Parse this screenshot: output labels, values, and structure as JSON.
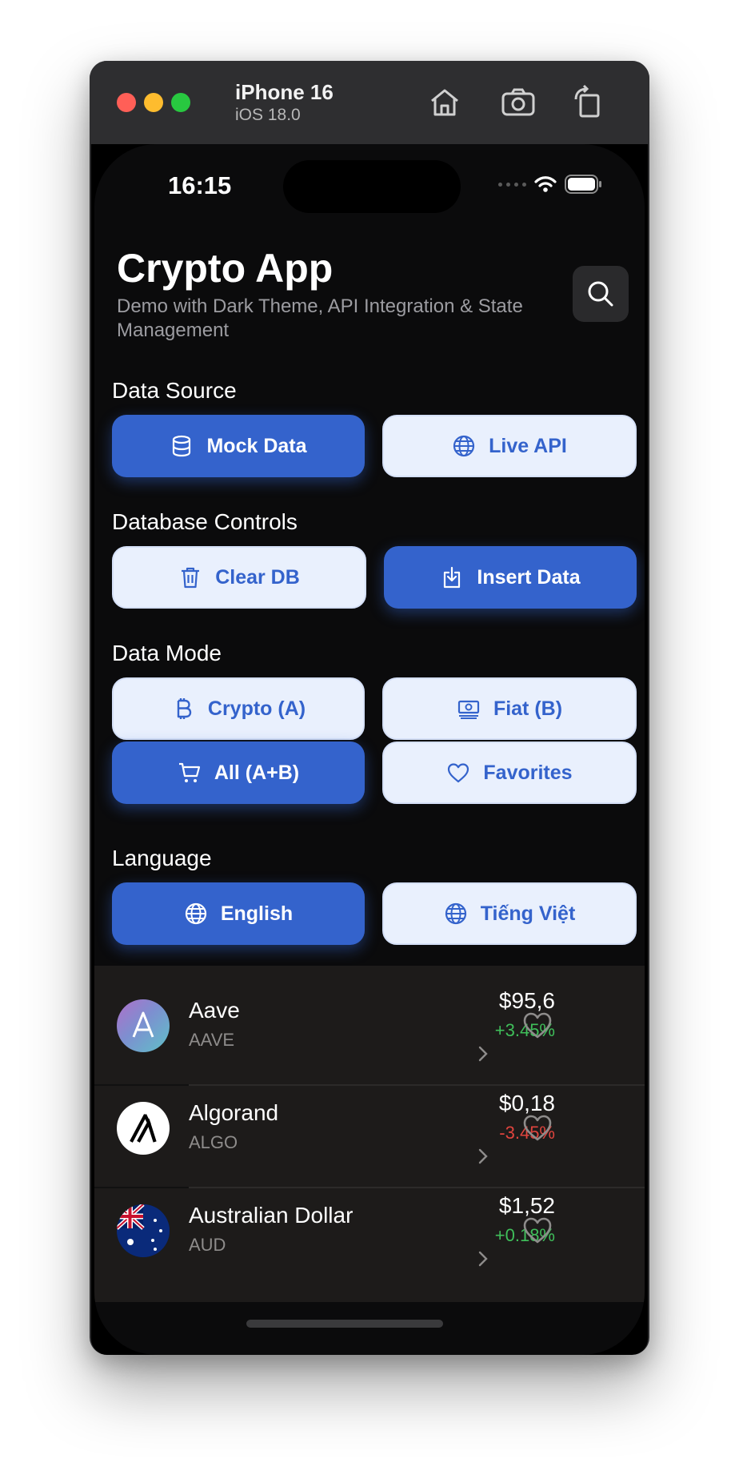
{
  "simulator": {
    "device_name": "iPhone 16",
    "os_version": "iOS 18.0",
    "traffic_lights": [
      "#ff5f57",
      "#febc2e",
      "#28c840"
    ]
  },
  "status_bar": {
    "time": "16:15"
  },
  "header": {
    "title": "Crypto App",
    "subtitle": "Demo with Dark Theme, API Integration & State Management"
  },
  "sections": {
    "data_source": {
      "label": "Data Source",
      "buttons": [
        {
          "label": "Mock Data",
          "icon": "database-icon",
          "active": true
        },
        {
          "label": "Live API",
          "icon": "globe-icon",
          "active": false
        }
      ]
    },
    "database_controls": {
      "label": "Database Controls",
      "buttons": [
        {
          "label": "Clear DB",
          "icon": "trash-icon",
          "active": false
        },
        {
          "label": "Insert Data",
          "icon": "download-icon",
          "active": true
        }
      ]
    },
    "data_mode": {
      "label": "Data Mode",
      "buttons": [
        {
          "label": "Crypto (A)",
          "icon": "bitcoin-icon",
          "active": false
        },
        {
          "label": "Fiat (B)",
          "icon": "banknote-icon",
          "active": false
        },
        {
          "label": "All (A+B)",
          "icon": "cart-icon",
          "active": true
        },
        {
          "label": "Favorites",
          "icon": "heart-icon",
          "active": false
        }
      ]
    },
    "language": {
      "label": "Language",
      "buttons": [
        {
          "label": "English",
          "icon": "globe-icon",
          "active": true
        },
        {
          "label": "Tiếng Việt",
          "icon": "globe-icon",
          "active": false
        }
      ]
    }
  },
  "list": [
    {
      "name": "Aave",
      "symbol": "AAVE",
      "price": "$95,6",
      "change": "+3.45%",
      "change_color": "#3fbf5a",
      "favorite": false
    },
    {
      "name": "Algorand",
      "symbol": "ALGO",
      "price": "$0,18",
      "change": "-3.45%",
      "change_color": "#e0443e",
      "favorite": false
    },
    {
      "name": "Australian Dollar",
      "symbol": "AUD",
      "price": "$1,52",
      "change": "+0.18%",
      "change_color": "#3fbf5a",
      "favorite": false
    }
  ],
  "colors": {
    "accent": "#3463cc",
    "secondary_bg": "#e9f0fd",
    "positive": "#3fbf5a",
    "negative": "#e0443e"
  }
}
